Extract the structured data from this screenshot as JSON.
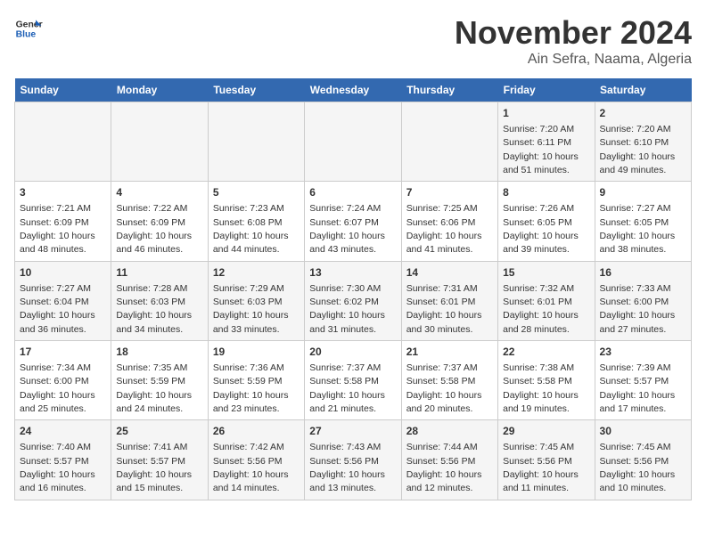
{
  "header": {
    "logo_general": "General",
    "logo_blue": "Blue",
    "title": "November 2024",
    "subtitle": "Ain Sefra, Naama, Algeria"
  },
  "calendar": {
    "days_of_week": [
      "Sunday",
      "Monday",
      "Tuesday",
      "Wednesday",
      "Thursday",
      "Friday",
      "Saturday"
    ],
    "weeks": [
      [
        {
          "day": "",
          "info": ""
        },
        {
          "day": "",
          "info": ""
        },
        {
          "day": "",
          "info": ""
        },
        {
          "day": "",
          "info": ""
        },
        {
          "day": "",
          "info": ""
        },
        {
          "day": "1",
          "info": "Sunrise: 7:20 AM\nSunset: 6:11 PM\nDaylight: 10 hours and 51 minutes."
        },
        {
          "day": "2",
          "info": "Sunrise: 7:20 AM\nSunset: 6:10 PM\nDaylight: 10 hours and 49 minutes."
        }
      ],
      [
        {
          "day": "3",
          "info": "Sunrise: 7:21 AM\nSunset: 6:09 PM\nDaylight: 10 hours and 48 minutes."
        },
        {
          "day": "4",
          "info": "Sunrise: 7:22 AM\nSunset: 6:09 PM\nDaylight: 10 hours and 46 minutes."
        },
        {
          "day": "5",
          "info": "Sunrise: 7:23 AM\nSunset: 6:08 PM\nDaylight: 10 hours and 44 minutes."
        },
        {
          "day": "6",
          "info": "Sunrise: 7:24 AM\nSunset: 6:07 PM\nDaylight: 10 hours and 43 minutes."
        },
        {
          "day": "7",
          "info": "Sunrise: 7:25 AM\nSunset: 6:06 PM\nDaylight: 10 hours and 41 minutes."
        },
        {
          "day": "8",
          "info": "Sunrise: 7:26 AM\nSunset: 6:05 PM\nDaylight: 10 hours and 39 minutes."
        },
        {
          "day": "9",
          "info": "Sunrise: 7:27 AM\nSunset: 6:05 PM\nDaylight: 10 hours and 38 minutes."
        }
      ],
      [
        {
          "day": "10",
          "info": "Sunrise: 7:27 AM\nSunset: 6:04 PM\nDaylight: 10 hours and 36 minutes."
        },
        {
          "day": "11",
          "info": "Sunrise: 7:28 AM\nSunset: 6:03 PM\nDaylight: 10 hours and 34 minutes."
        },
        {
          "day": "12",
          "info": "Sunrise: 7:29 AM\nSunset: 6:03 PM\nDaylight: 10 hours and 33 minutes."
        },
        {
          "day": "13",
          "info": "Sunrise: 7:30 AM\nSunset: 6:02 PM\nDaylight: 10 hours and 31 minutes."
        },
        {
          "day": "14",
          "info": "Sunrise: 7:31 AM\nSunset: 6:01 PM\nDaylight: 10 hours and 30 minutes."
        },
        {
          "day": "15",
          "info": "Sunrise: 7:32 AM\nSunset: 6:01 PM\nDaylight: 10 hours and 28 minutes."
        },
        {
          "day": "16",
          "info": "Sunrise: 7:33 AM\nSunset: 6:00 PM\nDaylight: 10 hours and 27 minutes."
        }
      ],
      [
        {
          "day": "17",
          "info": "Sunrise: 7:34 AM\nSunset: 6:00 PM\nDaylight: 10 hours and 25 minutes."
        },
        {
          "day": "18",
          "info": "Sunrise: 7:35 AM\nSunset: 5:59 PM\nDaylight: 10 hours and 24 minutes."
        },
        {
          "day": "19",
          "info": "Sunrise: 7:36 AM\nSunset: 5:59 PM\nDaylight: 10 hours and 23 minutes."
        },
        {
          "day": "20",
          "info": "Sunrise: 7:37 AM\nSunset: 5:58 PM\nDaylight: 10 hours and 21 minutes."
        },
        {
          "day": "21",
          "info": "Sunrise: 7:37 AM\nSunset: 5:58 PM\nDaylight: 10 hours and 20 minutes."
        },
        {
          "day": "22",
          "info": "Sunrise: 7:38 AM\nSunset: 5:58 PM\nDaylight: 10 hours and 19 minutes."
        },
        {
          "day": "23",
          "info": "Sunrise: 7:39 AM\nSunset: 5:57 PM\nDaylight: 10 hours and 17 minutes."
        }
      ],
      [
        {
          "day": "24",
          "info": "Sunrise: 7:40 AM\nSunset: 5:57 PM\nDaylight: 10 hours and 16 minutes."
        },
        {
          "day": "25",
          "info": "Sunrise: 7:41 AM\nSunset: 5:57 PM\nDaylight: 10 hours and 15 minutes."
        },
        {
          "day": "26",
          "info": "Sunrise: 7:42 AM\nSunset: 5:56 PM\nDaylight: 10 hours and 14 minutes."
        },
        {
          "day": "27",
          "info": "Sunrise: 7:43 AM\nSunset: 5:56 PM\nDaylight: 10 hours and 13 minutes."
        },
        {
          "day": "28",
          "info": "Sunrise: 7:44 AM\nSunset: 5:56 PM\nDaylight: 10 hours and 12 minutes."
        },
        {
          "day": "29",
          "info": "Sunrise: 7:45 AM\nSunset: 5:56 PM\nDaylight: 10 hours and 11 minutes."
        },
        {
          "day": "30",
          "info": "Sunrise: 7:45 AM\nSunset: 5:56 PM\nDaylight: 10 hours and 10 minutes."
        }
      ]
    ]
  }
}
